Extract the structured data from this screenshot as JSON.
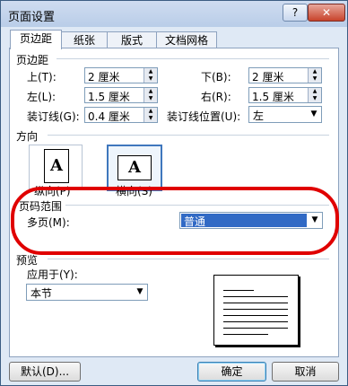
{
  "window": {
    "title": "页面设置",
    "help_label": "?",
    "close_label": "✕"
  },
  "tabs": [
    "页边距",
    "纸张",
    "版式",
    "文档网格"
  ],
  "margins": {
    "section_title": "页边距",
    "top_label": "上(T):",
    "top_value": "2 厘米",
    "bottom_label": "下(B):",
    "bottom_value": "2 厘米",
    "left_label": "左(L):",
    "left_value": "1.5 厘米",
    "right_label": "右(R):",
    "right_value": "1.5 厘米",
    "gutter_label": "装订线(G):",
    "gutter_value": "0.4 厘米",
    "gutter_pos_label": "装订线位置(U):",
    "gutter_pos_value": "左"
  },
  "orientation": {
    "section_title": "方向",
    "portrait_label": "纵向(P)",
    "portrait_glyph": "A",
    "landscape_label": "横向(S)",
    "landscape_glyph": "A",
    "selected": "landscape"
  },
  "pages": {
    "section_title": "页码范围",
    "multiple_label": "多页(M):",
    "multiple_value": "普通"
  },
  "preview": {
    "section_title": "预览",
    "apply_label": "应用于(Y):",
    "apply_value": "本节"
  },
  "buttons": {
    "default": "默认(D)...",
    "ok": "确定",
    "cancel": "取消"
  },
  "colors": {
    "annotation_ring": "#e00000",
    "selection": "#3f77bd"
  }
}
